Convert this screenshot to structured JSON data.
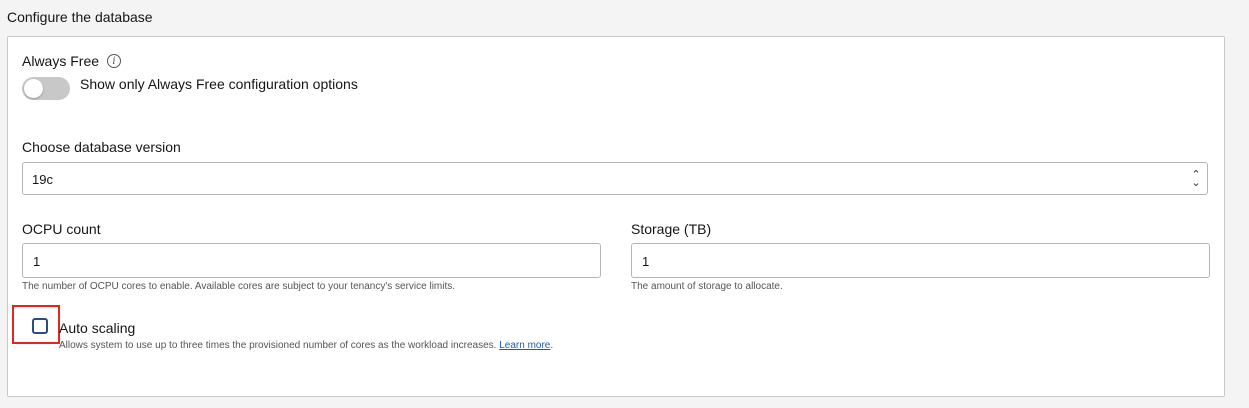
{
  "section": {
    "title": "Configure the database"
  },
  "always_free": {
    "label": "Always Free",
    "toggle_text": "Show only Always Free configuration options",
    "toggle_on": false
  },
  "db_version": {
    "label": "Choose database version",
    "value": "19c"
  },
  "ocpu": {
    "label": "OCPU count",
    "value": "1",
    "help": "The number of OCPU cores to enable. Available cores are subject to your tenancy's service limits."
  },
  "storage": {
    "label": "Storage (TB)",
    "value": "1",
    "help": "The amount of storage to allocate."
  },
  "auto_scaling": {
    "label": "Auto scaling",
    "checked": false,
    "help": "Allows system to use up to three times the provisioned number of cores as the workload increases.",
    "link": "Learn more",
    "link_suffix": "."
  },
  "colors": {
    "highlight": "#e0261f",
    "link": "#1b5fa8",
    "checkbox_border": "#2a4e7c"
  }
}
